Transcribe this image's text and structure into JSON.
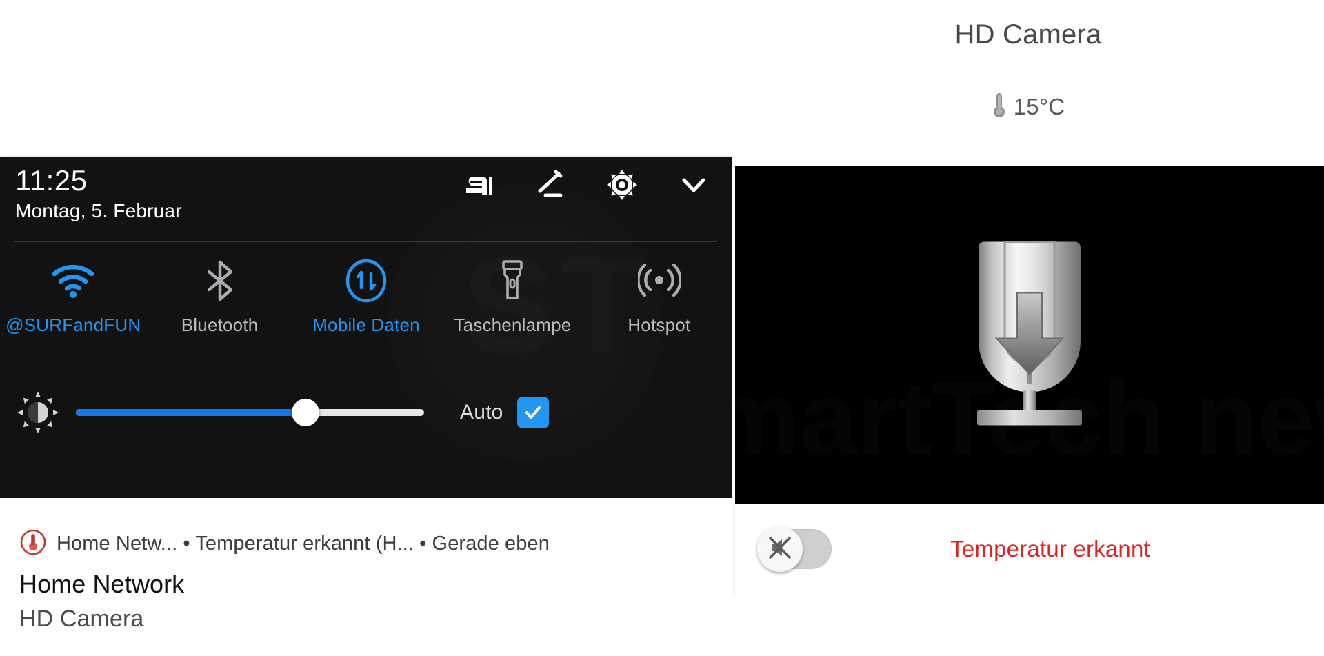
{
  "watermark": {
    "text": "SmartTech news"
  },
  "quick_settings": {
    "clock": "11:25",
    "date": "Montag, 5. Februar",
    "header_icons": [
      {
        "name": "samsung-pass-icon",
        "label": "Samsung Pass"
      },
      {
        "name": "edit-icon",
        "label": "Bearbeiten"
      },
      {
        "name": "gear-icon",
        "label": "Einstellungen"
      },
      {
        "name": "chevron-down-icon",
        "label": "Mehr anzeigen"
      }
    ],
    "tiles": [
      {
        "icon": "wifi-icon",
        "label": "@SURFandFUN",
        "active": true
      },
      {
        "icon": "bluetooth-icon",
        "label": "Bluetooth",
        "active": false
      },
      {
        "icon": "mobile-data-icon",
        "label": "Mobile Daten",
        "active": true
      },
      {
        "icon": "flashlight-icon",
        "label": "Taschenlampe",
        "active": false
      },
      {
        "icon": "hotspot-icon",
        "label": "Hotspot",
        "active": false
      }
    ],
    "brightness": {
      "icon": "brightness-icon",
      "value_percent": 66,
      "auto_label": "Auto",
      "auto_enabled": true,
      "fill_color": "#1877e8",
      "track_color": "#e8e6e3",
      "accent_color": "#2196f3"
    }
  },
  "notification": {
    "app_icon": "thermometer-alert-icon",
    "meta": "Home Netw... • Temperatur erkannt (H... • Gerade eben",
    "title": "Home Network",
    "body": "HD Camera"
  },
  "camera": {
    "title": "HD Camera",
    "temperature_icon": "thermometer-icon",
    "temperature": "15°C",
    "video_icon": "usb-download-icon",
    "mute_toggle": {
      "icon": "speaker-muted-icon",
      "state": "off"
    },
    "alert_text": "Temperatur erkannt",
    "alert_color": "#e3221f"
  }
}
